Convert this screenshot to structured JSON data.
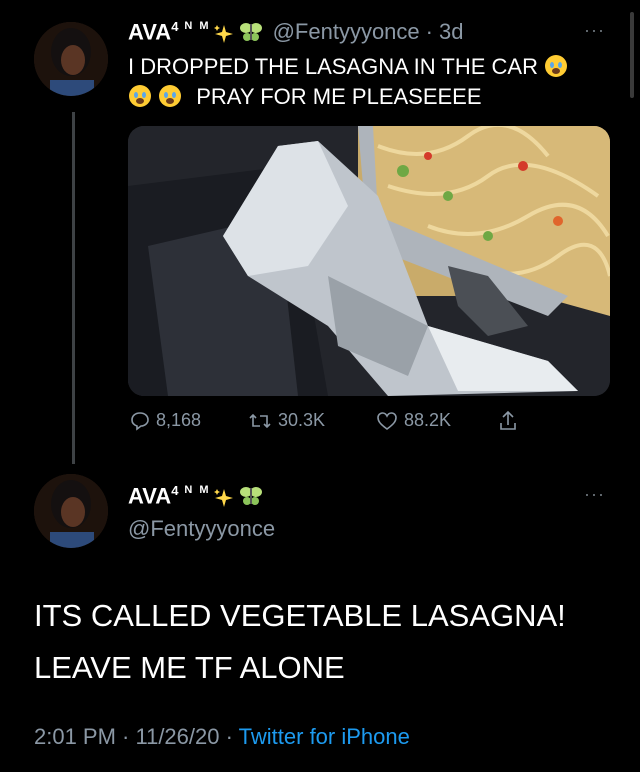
{
  "tweet1": {
    "display_name": "AVA",
    "superscript": "4",
    "name_suffix": "N M",
    "handle": "@Fentyyyonce",
    "separator": "·",
    "time": "3d",
    "more_label": "···",
    "text_line1": "I DROPPED THE LASAGNA IN THE CAR",
    "text_line2": "PRAY FOR ME PLEASEEEE",
    "actions": {
      "replies": "8,168",
      "retweets": "30.3K",
      "likes": "88.2K"
    }
  },
  "tweet2": {
    "display_name": "AVA",
    "superscript": "4",
    "name_suffix": "N M",
    "handle": "@Fentyyyonce",
    "more_label": "···",
    "text_line1": "ITS CALLED VEGETABLE LASAGNA!",
    "text_line2": "LEAVE ME TF ALONE",
    "timestamp": "2:01 PM · 11/26/20",
    "meta_separator": "·",
    "source": "Twitter for iPhone"
  },
  "icons": [
    "sparkles-icon",
    "butterfly-icon",
    "crying-face-icon",
    "reply-icon",
    "retweet-icon",
    "like-icon",
    "share-icon"
  ],
  "colors": {
    "background": "#000000",
    "secondary_text": "#8b98a5",
    "link": "#1d9bf0",
    "thread_line": "#3e4245"
  }
}
